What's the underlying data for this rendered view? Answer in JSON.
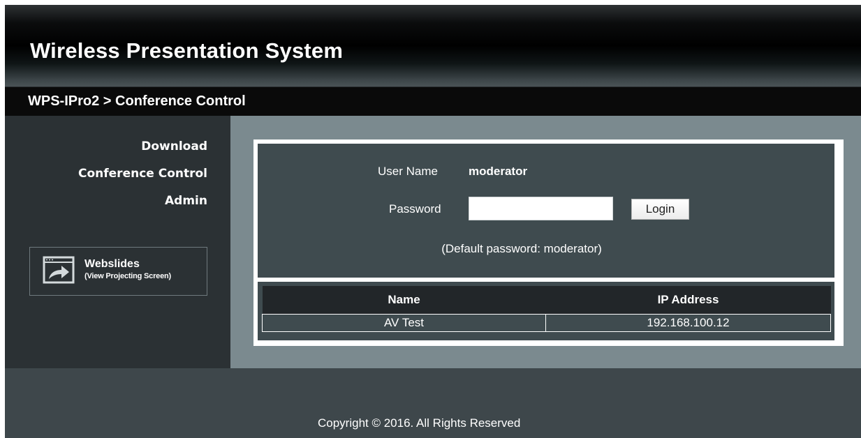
{
  "header": {
    "title": "Wireless Presentation System",
    "breadcrumb": "WPS-IPro2 > Conference Control"
  },
  "sidebar": {
    "items": [
      {
        "label": "Download"
      },
      {
        "label": "Conference Control"
      },
      {
        "label": "Admin"
      }
    ],
    "webslides": {
      "title": "Webslides",
      "subtitle": "(View Projecting Screen)",
      "icon": "projector-screen-arrow-icon"
    }
  },
  "login": {
    "username_label": "User Name",
    "username_value": "moderator",
    "password_label": "Password",
    "password_value": "",
    "password_placeholder": "",
    "login_button": "Login",
    "default_note": "(Default password: moderator)"
  },
  "clients_table": {
    "columns": [
      "Name",
      "IP Address"
    ],
    "rows": [
      [
        "AV Test",
        "192.168.100.12"
      ]
    ]
  },
  "footer": {
    "copyright": "Copyright © 2016. All Rights Reserved"
  },
  "colors": {
    "page_background": "#3e474b",
    "sidebar_background": "#2b3134",
    "content_background": "#7b8a8f",
    "panel_background": "#3f4b4f",
    "table_header_background": "#222629"
  }
}
